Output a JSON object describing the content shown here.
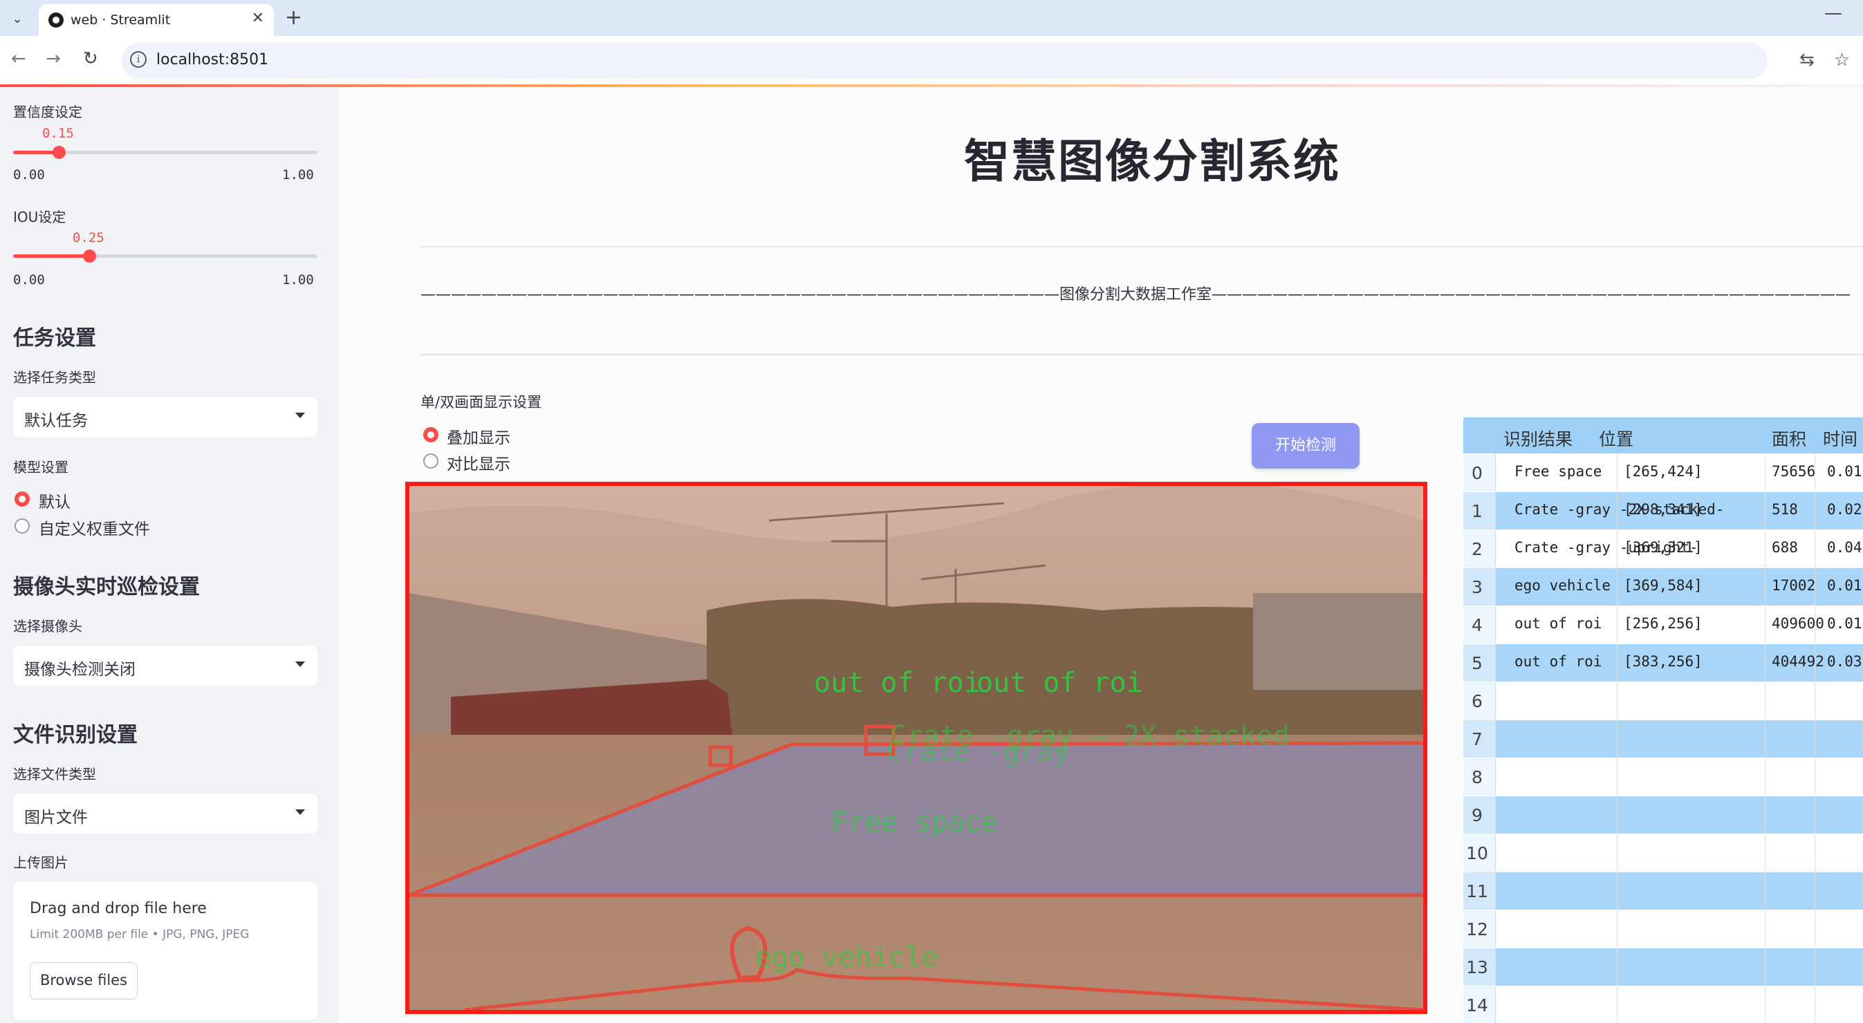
{
  "browser": {
    "tab_title": "web · Streamlit",
    "url": "localhost:8501"
  },
  "sidebar": {
    "confidence": {
      "label": "置信度设定",
      "value": "0.15",
      "value_num": 0.15,
      "min": "0.00",
      "max": "1.00"
    },
    "iou": {
      "label": "IOU设定",
      "value": "0.25",
      "value_num": 0.25,
      "min": "0.00",
      "max": "1.00"
    },
    "task": {
      "heading": "任务设置",
      "type_label": "选择任务类型",
      "type_value": "默认任务"
    },
    "model": {
      "label": "模型设置",
      "options": [
        "默认",
        "自定义权重文件"
      ],
      "selected": 0
    },
    "camera": {
      "heading": "摄像头实时巡检设置",
      "select_label": "选择摄像头",
      "select_value": "摄像头检测关闭"
    },
    "file": {
      "heading": "文件识别设置",
      "type_label": "选择文件类型",
      "type_value": "图片文件",
      "upload_label": "上传图片"
    },
    "uploader": {
      "title": "Drag and drop file here",
      "hint": "Limit 200MB per file • JPG, PNG, JPEG",
      "button": "Browse files"
    }
  },
  "main": {
    "title": "智慧图像分割系统",
    "banner": "——————————————————————————————————————————图像分割大数据工作室——————————————————————————————————————————",
    "display_mode": {
      "label": "单/双画面显示设置",
      "options": [
        "叠加显示",
        "对比显示"
      ],
      "selected": 0
    },
    "start_button": "开始检测",
    "overlay_labels": {
      "roi_1": "out of roi",
      "roi_2": "out of roi",
      "crate_1": "Crate -gray",
      "crate_2": "Crate -gray — 2X stacked",
      "free_space": "Free space",
      "ego": "ego vehicle"
    }
  },
  "table": {
    "headers": [
      "识别结果",
      "位置",
      "面积",
      "时间"
    ],
    "rows": [
      {
        "idx": "0",
        "result": "Free space",
        "pos": "[265,424]",
        "area": "75656",
        "time": "0.01"
      },
      {
        "idx": "1",
        "result": "Crate -gray -2X stacked-",
        "pos": "[298,341]",
        "area": "518",
        "time": "0.02"
      },
      {
        "idx": "2",
        "result": "Crate -gray -upright-",
        "pos": "[369,321]",
        "area": "688",
        "time": "0.04"
      },
      {
        "idx": "3",
        "result": "ego vehicle",
        "pos": "[369,584]",
        "area": "17002",
        "time": "0.01"
      },
      {
        "idx": "4",
        "result": "out of roi",
        "pos": "[256,256]",
        "area": "409600",
        "time": "0.01"
      },
      {
        "idx": "5",
        "result": "out of roi",
        "pos": "[383,256]",
        "area": "404492",
        "time": "0.03"
      },
      {
        "idx": "6"
      },
      {
        "idx": "7"
      },
      {
        "idx": "8"
      },
      {
        "idx": "9"
      },
      {
        "idx": "10"
      },
      {
        "idx": "11"
      },
      {
        "idx": "12"
      },
      {
        "idx": "13"
      },
      {
        "idx": "14"
      }
    ]
  },
  "colors": {
    "accent": "#ff4b4b",
    "button": "#8f98f3",
    "table_header": "#9fd0f7",
    "table_stripe": "#a9d5f8",
    "viewer_border": "#ff1a1a",
    "overlay_text": "#2ecc40"
  }
}
